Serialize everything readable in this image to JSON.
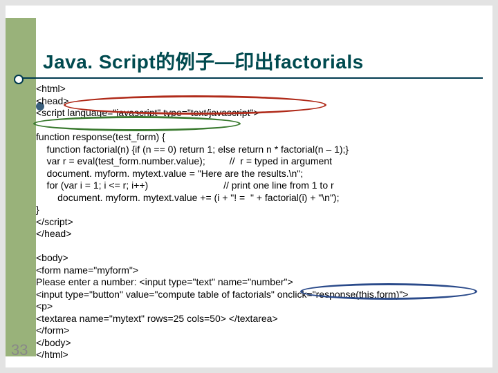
{
  "title": "Java. Script的例子—印出factorials",
  "page_number": "33",
  "code_lines": [
    "<html>",
    "<head>",
    "<script language=\"javascript\" type=\"text/javascript\">",
    "",
    "function response(test_form) {",
    "    function factorial(n) {if (n == 0) return 1; else return n * factorial(n – 1);}",
    "    var r = eval(test_form.number.value);         //  r = typed in argument",
    "    document. myform. mytext.value = \"Here are the results.\\n\";",
    "    for (var i = 1; i <= r; i++)                            // print one line from 1 to r",
    "        document. myform. mytext.value += (i + \"! =  \" + factorial(i) + \"\\n\");",
    "}",
    "</script>",
    "</head>",
    "",
    "<body>",
    "<form name=\"myform\">",
    "Please enter a number: <input type=\"text\" name=\"number\">",
    "<input type=\"button\" value=\"compute table of factorials\" onclick=\"response(this.form)\">",
    "<p>",
    "<textarea name=\"mytext\" rows=25 cols=50> </textarea>",
    "</form>",
    "</body>",
    "</html>"
  ]
}
